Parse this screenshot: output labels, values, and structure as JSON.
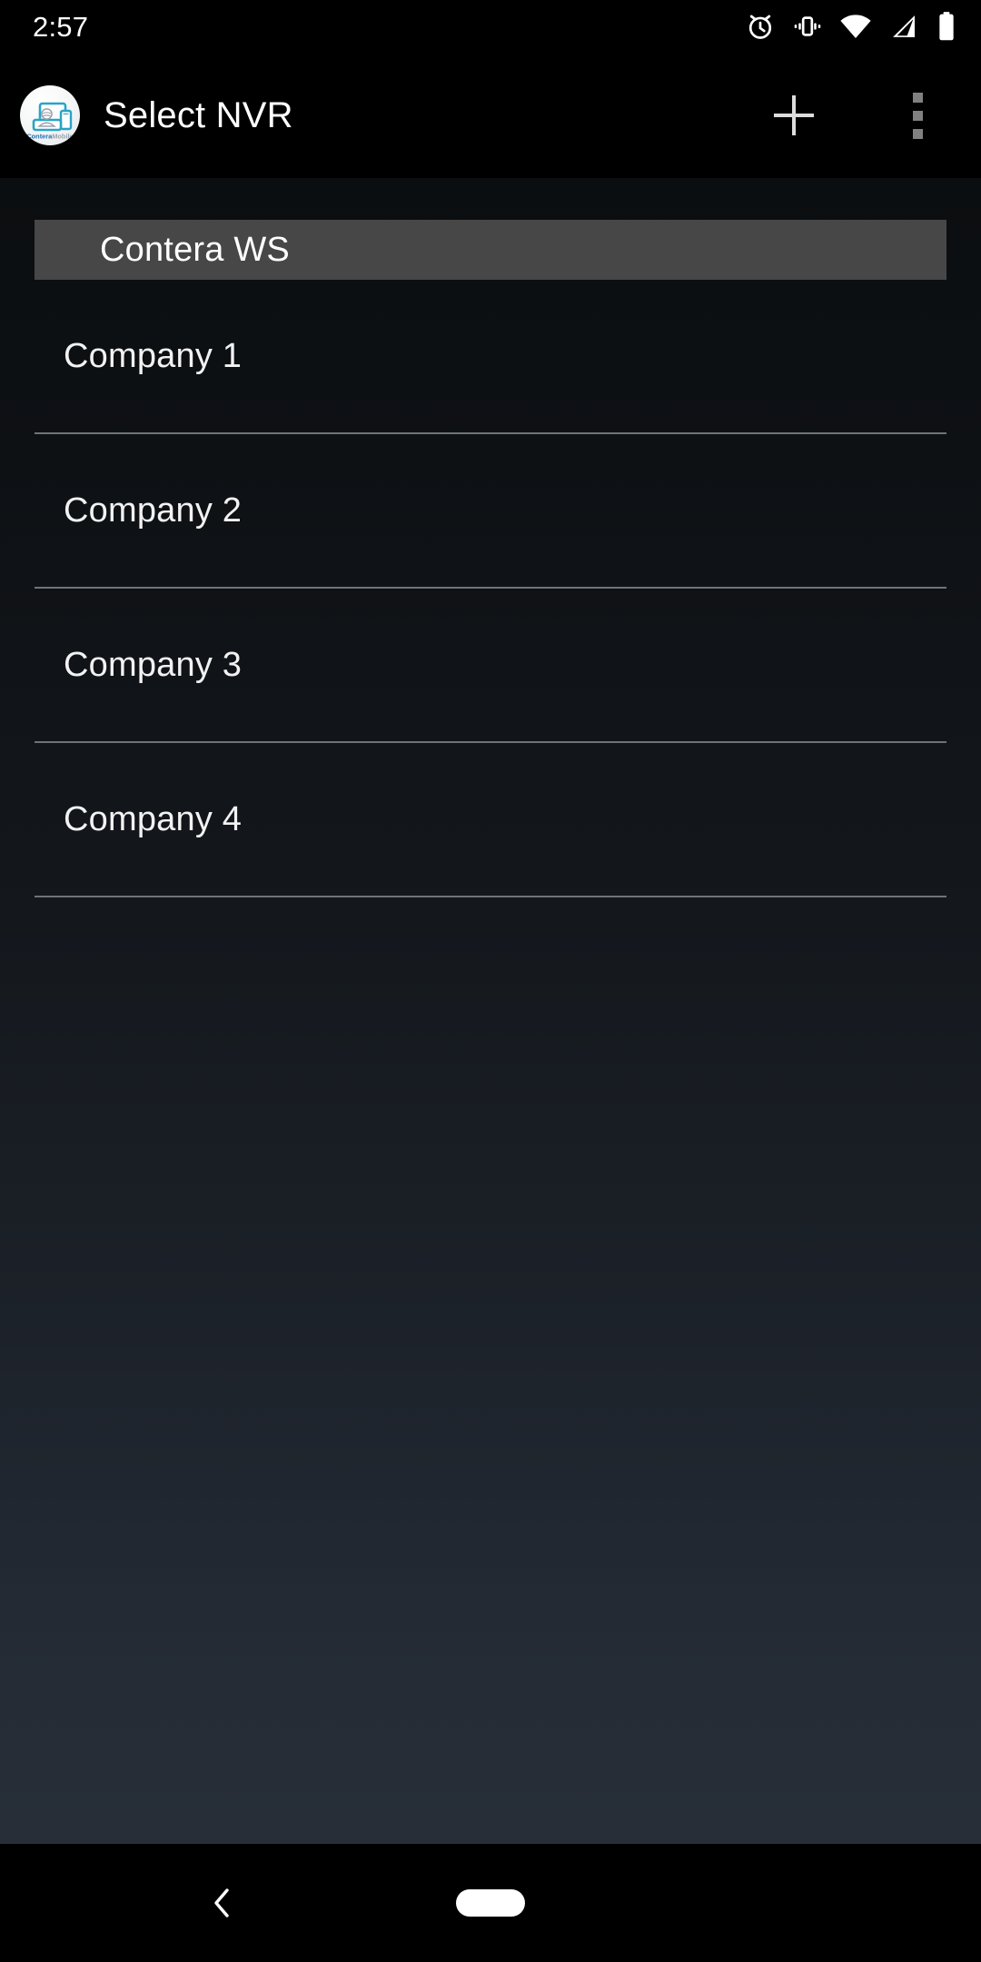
{
  "status_bar": {
    "time": "2:57",
    "icons": [
      {
        "name": "alarm-icon",
        "label": "alarm"
      },
      {
        "name": "vibrate-icon",
        "label": "vibrate"
      },
      {
        "name": "wifi-icon",
        "label": "wifi"
      },
      {
        "name": "cellular-signal-icon",
        "label": "signal"
      },
      {
        "name": "battery-icon",
        "label": "battery"
      }
    ]
  },
  "app_bar": {
    "title": "Select NVR",
    "logo_text_primary": "Contera",
    "logo_text_secondary": "Mobile",
    "add_label": "+",
    "overflow_label": "More options"
  },
  "content": {
    "section_header": "Contera WS",
    "items": [
      {
        "label": "Company 1"
      },
      {
        "label": "Company 2"
      },
      {
        "label": "Company 3"
      },
      {
        "label": "Company 4"
      }
    ]
  },
  "nav_bar": {
    "back_label": "Back",
    "home_label": "Home"
  },
  "colors": {
    "section_header_bg": "#474747",
    "divider": "#6f7478",
    "text_primary": "#ffffff",
    "overflow_dot": "#808080",
    "logo_accent": "#2aa3c7",
    "logo_text": "#1f6fb5"
  }
}
